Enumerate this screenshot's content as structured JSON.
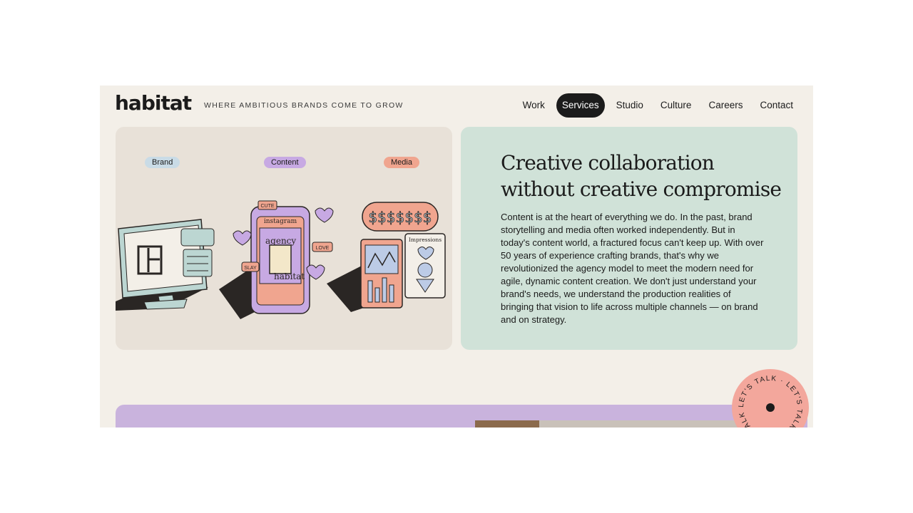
{
  "brand": {
    "logo": "habitat",
    "tagline": "WHERE AMBITIOUS BRANDS COME TO GROW"
  },
  "nav": {
    "items": [
      {
        "label": "Work",
        "active": false
      },
      {
        "label": "Services",
        "active": true
      },
      {
        "label": "Studio",
        "active": false
      },
      {
        "label": "Culture",
        "active": false
      },
      {
        "label": "Careers",
        "active": false
      },
      {
        "label": "Contact",
        "active": false
      }
    ]
  },
  "illustration": {
    "labels": {
      "brand": "Brand",
      "content": "Content",
      "media": "Media"
    },
    "phone": {
      "app": "instagram",
      "word1": "agency",
      "word2": "habitat",
      "tag_cute": "CUTE",
      "tag_love": "LOVE",
      "tag_slay": "SLAY"
    },
    "billboard": {
      "money": "$$$$$$$",
      "impressions": "Impressions"
    }
  },
  "hero": {
    "headline_line1": "Creative collaboration",
    "headline_line2": "without creative compromise",
    "body": "Content is at the heart of everything we do. In the past, brand storytelling and media often worked independently. But in today's content world, a fractured focus can't keep up. With over 50 years of experience crafting brands, that's why we revolutionized the agency model to meet the modern need for agile, dynamic content creation. We don't just understand your brand's needs, we understand the production realities of bringing that vision to life across multiple channels — on brand and on strategy."
  },
  "cta": {
    "label": "LET'S TALK · LET'S TALK · LET'S TALK ·"
  },
  "colors": {
    "page_bg": "#f3efe8",
    "illustration_bg": "#e8e1d8",
    "text_card_bg": "#d0e2d8",
    "purple_band": "#c9b3dd",
    "badge": "#f3a79c",
    "ink": "#1b1b1b"
  }
}
